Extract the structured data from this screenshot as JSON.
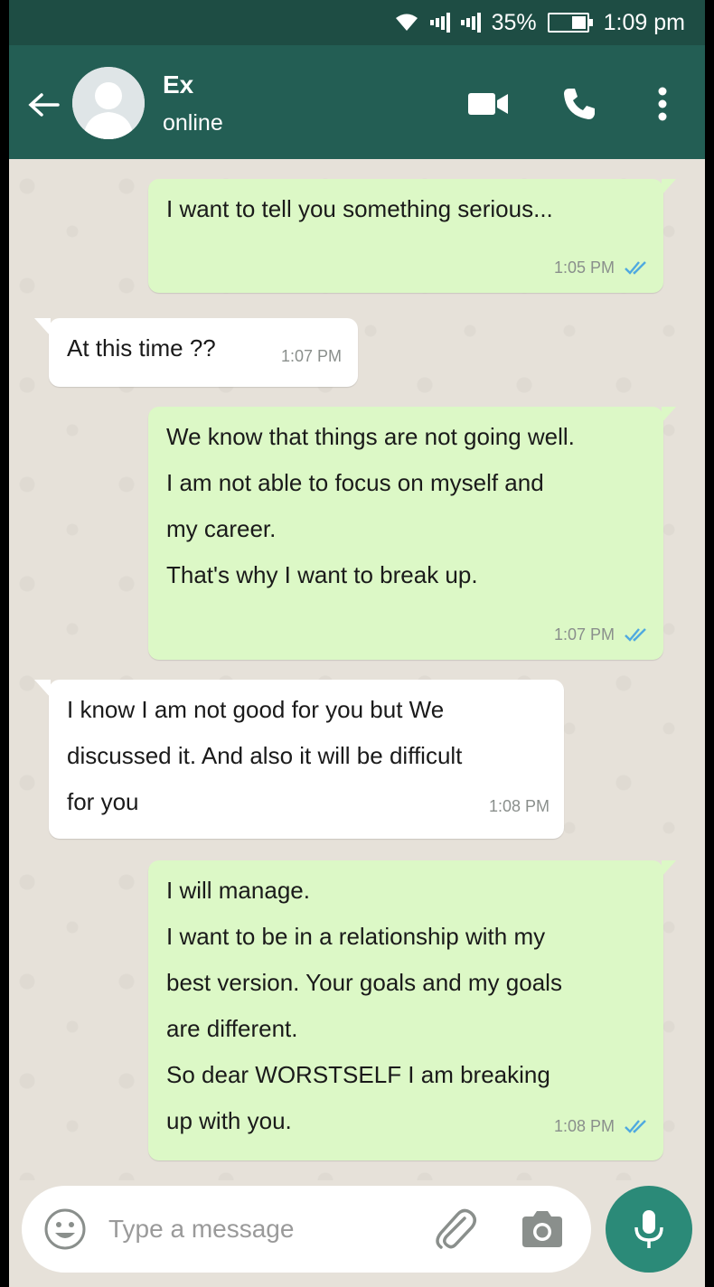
{
  "status_bar": {
    "battery": "35%",
    "time": "1:09 pm",
    "icons": [
      "wifi-icon",
      "signal-icon",
      "signal-icon",
      "battery-icon"
    ]
  },
  "header": {
    "contact_name": "Ex",
    "contact_status": "online",
    "icons": [
      "back-arrow-icon",
      "avatar-placeholder-icon",
      "video-call-icon",
      "phone-icon",
      "more-vert-icon"
    ]
  },
  "messages": [
    {
      "direction": "outgoing",
      "lines": [
        "I want to tell you something serious..."
      ],
      "time": "1:05 PM",
      "status": "read"
    },
    {
      "direction": "incoming",
      "lines": [
        "At this time ??"
      ],
      "time": "1:07 PM"
    },
    {
      "direction": "outgoing",
      "lines": [
        "We know that things are not going well.",
        "I am not able to focus on myself and",
        "my career.",
        "That's why I want to break up."
      ],
      "time": "1:07 PM",
      "status": "read"
    },
    {
      "direction": "incoming",
      "lines": [
        "I know I am not good for you but We",
        "discussed it. And also it will be difficult",
        "for you"
      ],
      "time": "1:08 PM"
    },
    {
      "direction": "outgoing",
      "lines": [
        "I will manage.",
        "I want to be in a relationship with my",
        "best version. Your goals and my goals",
        "are different.",
        "So dear WORSTSELF I am breaking",
        "up with you."
      ],
      "time": "1:08 PM",
      "status": "read"
    }
  ],
  "composer": {
    "placeholder": "Type a message",
    "value": "",
    "icons": [
      "emoji-icon",
      "attachment-icon",
      "camera-icon",
      "mic-icon"
    ]
  },
  "colors": {
    "header": "#235e54",
    "status_bar": "#1e4d44",
    "outgoing_bubble": "#dcf8c6",
    "incoming_bubble": "#ffffff",
    "chat_background": "#e6e1d9",
    "read_tick": "#4fa9e0",
    "mic_button": "#2b8a78"
  }
}
